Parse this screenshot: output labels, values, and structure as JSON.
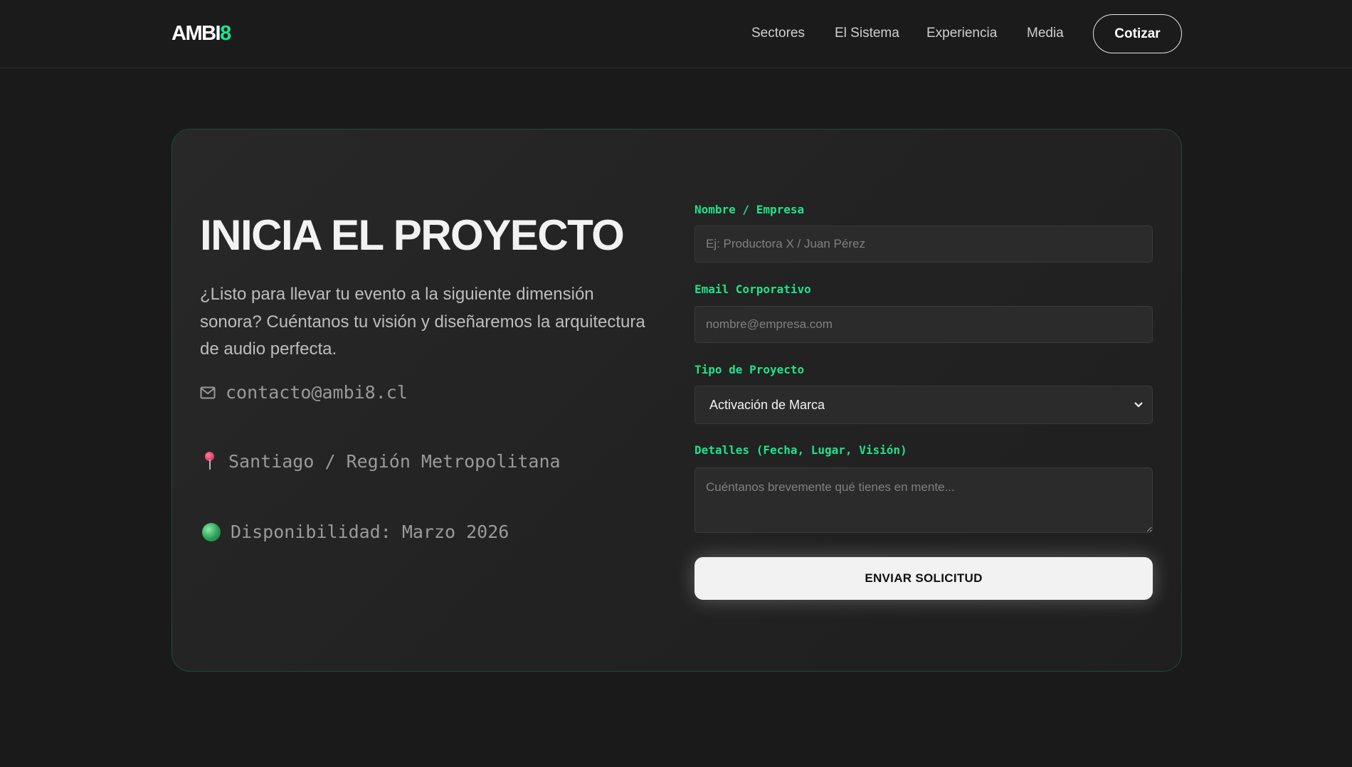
{
  "header": {
    "logo_main": "AMBI",
    "logo_accent": "8",
    "nav": [
      "Sectores",
      "El Sistema",
      "Experiencia",
      "Media"
    ],
    "cta_label": "Cotizar"
  },
  "hero": {
    "title": "INICIA EL PROYECTO",
    "lead": "¿Listo para llevar tu evento a la siguiente dimensión sonora? Cuéntanos tu visión y diseñaremos la arquitectura de audio perfecta.",
    "email": "contacto@ambi8.cl",
    "location": "Santiago / Región Metropolitana",
    "availability": "Disponibilidad: Marzo 2026"
  },
  "form": {
    "name_label": "Nombre / Empresa",
    "name_placeholder": "Ej: Productora X / Juan Pérez",
    "name_value": "",
    "email_label": "Email Corporativo",
    "email_placeholder": "nombre@empresa.com",
    "email_value": "",
    "type_label": "Tipo de Proyecto",
    "type_selected": "Activación de Marca",
    "details_label": "Detalles (Fecha, Lugar, Visión)",
    "details_placeholder": "Cuéntanos brevemente qué tienes en mente...",
    "details_value": "",
    "submit_label": "ENVIAR SOLICITUD"
  },
  "icons": {
    "mail": "mail-icon",
    "location": "pin-icon",
    "availability": "globe-icon",
    "select": "chevron-down-icon"
  },
  "colors": {
    "accent": "#1ee38a",
    "background": "#1a1a1a",
    "card_border": "#1f4a36"
  }
}
